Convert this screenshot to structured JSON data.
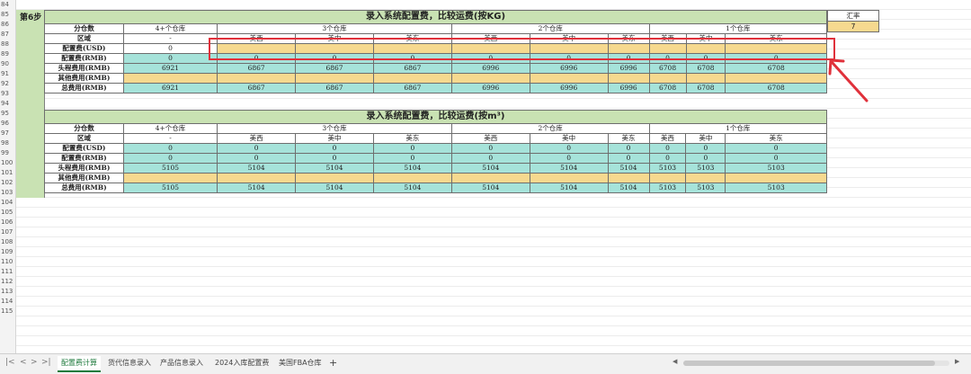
{
  "row_numbers": [
    "84",
    "85",
    "86",
    "87",
    "88",
    "89",
    "90",
    "91",
    "92",
    "93",
    "94",
    "95",
    "96",
    "97",
    "98",
    "99",
    "100",
    "101",
    "102",
    "103",
    "104",
    "105",
    "106",
    "107",
    "108",
    "109",
    "110",
    "111",
    "112",
    "113",
    "114",
    "115"
  ],
  "step_label": "第6步",
  "rate": {
    "label": "汇率",
    "value": "7"
  },
  "table1": {
    "title": "录入系统配置费，比较运费(按KG)",
    "row_labels": {
      "warehouses": "分仓数",
      "region": "区域",
      "fee_usd": "配置费(USD)",
      "fee_rmb": "配置费(RMB)",
      "head": "头程费用(RMB)",
      "other": "其他费用(RMB)",
      "total": "总费用(RMB)"
    },
    "groups": [
      "4+个仓库",
      "3个仓库",
      "2个仓库",
      "1个仓库"
    ],
    "regions": [
      "-",
      "美西",
      "美中",
      "美东",
      "美西",
      "美中",
      "美东",
      "美西",
      "美中",
      "美东"
    ],
    "fee_usd": [
      "0",
      "",
      "",
      "",
      "",
      "",
      "",
      "",
      "",
      ""
    ],
    "fee_rmb": [
      "0",
      "0",
      "0",
      "0",
      "0",
      "0",
      "0",
      "0",
      "0",
      "0"
    ],
    "head": [
      "6921",
      "6867",
      "6867",
      "6867",
      "6996",
      "6996",
      "6996",
      "6708",
      "6708",
      "6708"
    ],
    "other": [
      "",
      "",
      "",
      "",
      "",
      "",
      "",
      "",
      "",
      ""
    ],
    "total": [
      "6921",
      "6867",
      "6867",
      "6867",
      "6996",
      "6996",
      "6996",
      "6708",
      "6708",
      "6708"
    ]
  },
  "table2": {
    "title": "录入系统配置费，比较运费(按m³)",
    "row_labels": {
      "warehouses": "分仓数",
      "region": "区域",
      "fee_usd": "配置费(USD)",
      "fee_rmb": "配置费(RMB)",
      "head": "头程费用(RMB)",
      "other": "其他费用(RMB)",
      "total": "总费用(RMB)"
    },
    "groups": [
      "4+个仓库",
      "3个仓库",
      "2个仓库",
      "1个仓库"
    ],
    "regions": [
      "-",
      "美西",
      "美中",
      "美东",
      "美西",
      "美中",
      "美东",
      "美西",
      "美中",
      "美东"
    ],
    "fee_usd": [
      "0",
      "0",
      "0",
      "0",
      "0",
      "0",
      "0",
      "0",
      "0",
      "0"
    ],
    "fee_rmb": [
      "0",
      "0",
      "0",
      "0",
      "0",
      "0",
      "0",
      "0",
      "0",
      "0"
    ],
    "head": [
      "5105",
      "5104",
      "5104",
      "5104",
      "5104",
      "5104",
      "5104",
      "5103",
      "5103",
      "5103"
    ],
    "other": [
      "",
      "",
      "",
      "",
      "",
      "",
      "",
      "",
      "",
      ""
    ],
    "total": [
      "5105",
      "5104",
      "5104",
      "5104",
      "5104",
      "5104",
      "5104",
      "5103",
      "5103",
      "5103"
    ]
  },
  "tabs": [
    "配置费计算",
    "货代信息录入",
    "产品信息录入",
    "2024入库配置费",
    "美国FBA仓库"
  ],
  "add_tab": "+",
  "colors": {
    "teal": "#a6e3da",
    "yellow": "#f6d98f",
    "green": "#c9e2b3",
    "highlight": "#e0313b"
  }
}
